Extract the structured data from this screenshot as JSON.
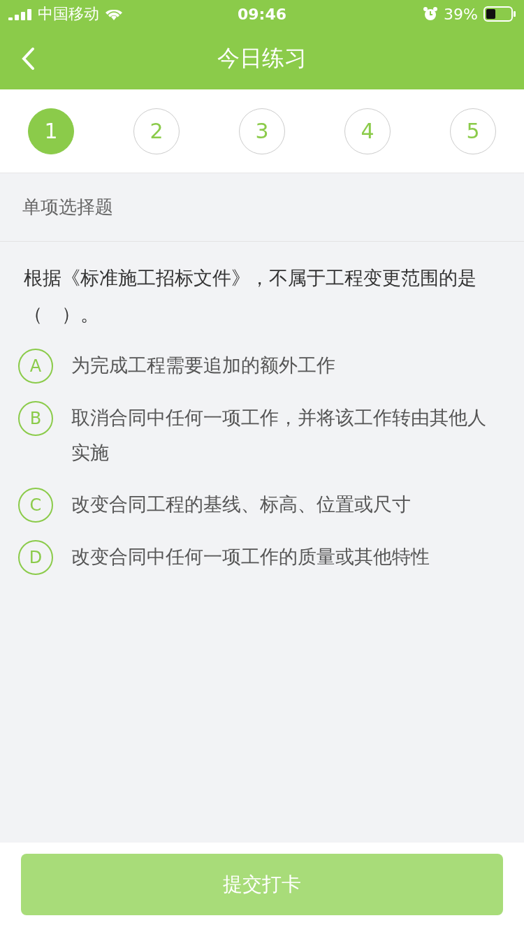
{
  "status_bar": {
    "carrier": "中国移动",
    "time": "09:46",
    "battery": "39%"
  },
  "nav": {
    "title": "今日练习"
  },
  "steps": [
    {
      "label": "1",
      "selected": true
    },
    {
      "label": "2",
      "selected": false
    },
    {
      "label": "3",
      "selected": false
    },
    {
      "label": "4",
      "selected": false
    },
    {
      "label": "5",
      "selected": false
    }
  ],
  "section": {
    "title": "单项选择题"
  },
  "question": "根据《标准施工招标文件》，不属于工程变更范围的是（　）。",
  "options": [
    {
      "letter": "A",
      "text": "为完成工程需要追加的额外工作",
      "selected": false
    },
    {
      "letter": "B",
      "text": "取消合同中任何一项工作，并将该工作转由其他人实施",
      "selected": false
    },
    {
      "letter": "C",
      "text": "改变合同工程的基线、标高、位置或尺寸",
      "selected": false
    },
    {
      "letter": "D",
      "text": "改变合同中任何一项工作的质量或其他特性",
      "selected": false
    }
  ],
  "submit": {
    "label": "提交打卡",
    "disabled": true
  }
}
